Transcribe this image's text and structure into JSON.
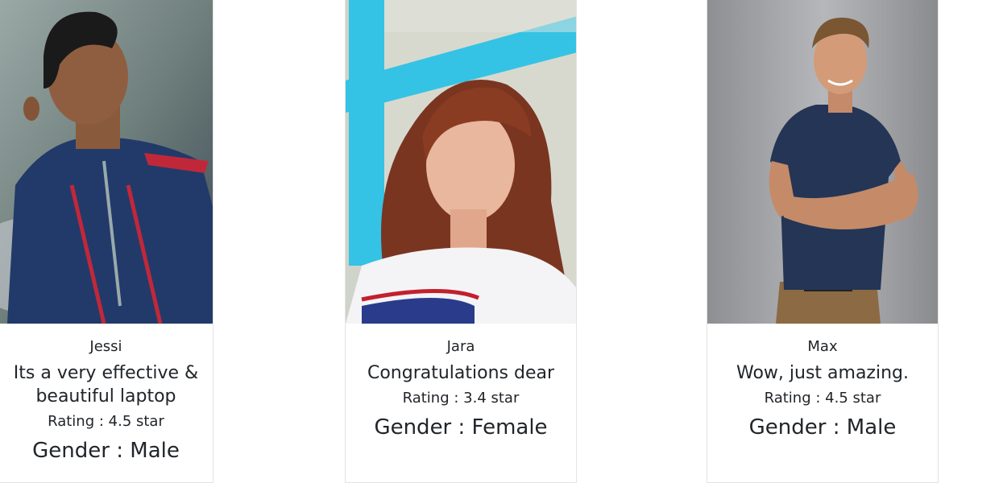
{
  "cards": [
    {
      "name": "Jessi",
      "review": "Its a very effective & beautiful laptop",
      "rating": "Rating : 4.5 star",
      "gender": "Gender : Male"
    },
    {
      "name": "Jara",
      "review": "Congratulations dear",
      "rating": "Rating : 3.4 star",
      "gender": "Gender : Female"
    },
    {
      "name": "Max",
      "review": "Wow, just amazing.",
      "rating": "Rating : 4.5 star",
      "gender": "Gender : Male"
    }
  ]
}
